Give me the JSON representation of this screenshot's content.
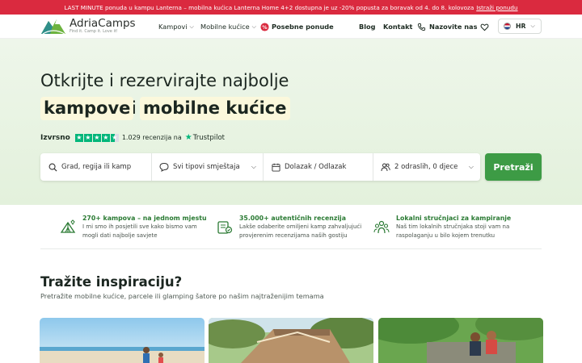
{
  "promo": {
    "text": "LAST MINUTE ponuda u kampu Lanterna – mobilna kućica Lanterna Home 4+2 dostupna je uz -20% popusta za boravak od 4. do 8. kolovoza",
    "link": "Istraži ponudu"
  },
  "header": {
    "logo_name": "AdriaCamps",
    "logo_tagline": "Find it. Camp it. Love it!",
    "nav": {
      "kampovi": "Kampovi",
      "mobilne": "Mobilne kućice",
      "posebne": "Posebne ponude",
      "blog": "Blog",
      "kontakt": "Kontakt",
      "nazovite": "Nazovite nas"
    },
    "language": "HR"
  },
  "hero": {
    "line1": "Otkrijte i rezervirajte najbolje",
    "highlight1": "kampove",
    "connector": "i",
    "highlight2": "mobilne kućice",
    "rating_label": "Izvrsno",
    "rating_count": "1.029 recenzija na",
    "trustpilot": "Trustpilot"
  },
  "search": {
    "destination_placeholder": "Grad, regija ili kamp",
    "type_value": "Svi tipovi smještaja",
    "dates_value": "Dolazak / Odlazak",
    "guests_value": "2 odraslih, 0 djece",
    "button": "Pretraži"
  },
  "features": [
    {
      "title": "270+ kampova – na jednom mjestu",
      "desc1": "I mi smo ih posjetili sve kako bismo vam",
      "desc2": "mogli dati najbolje savjete",
      "icon": "tent-map-icon"
    },
    {
      "title": "35.000+ autentičnih recenzija",
      "desc1": "Lakše odaberite omiljeni kamp zahvaljujući",
      "desc2": "provjerenim recenzijama naših gostiju",
      "icon": "reviews-icon"
    },
    {
      "title": "Lokalni stručnjaci za kampiranje",
      "desc1": "Naš tim lokalnih stručnjaka stoji vam na",
      "desc2": "raspolaganju u bilo kojem trenutku",
      "icon": "team-icon"
    }
  ],
  "inspiration": {
    "title": "Tražite inspiraciju?",
    "subtitle": "Pretražite mobilne kućice, parcele ili glamping šatore po našim najtraženijim temama"
  },
  "colors": {
    "promo_bg": "#da2a3f",
    "accent_green": "#3d9b45",
    "feature_title": "#2a7a33",
    "hero_bg": "#e3f1dc",
    "highlight_bg": "#fbf8dc"
  }
}
